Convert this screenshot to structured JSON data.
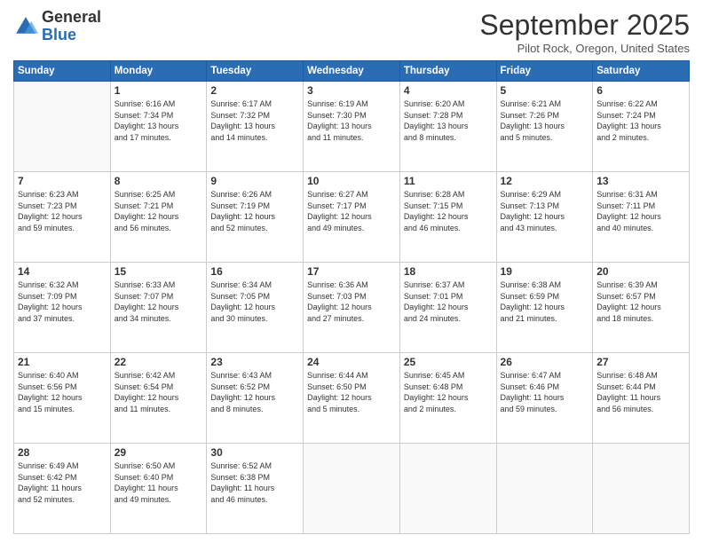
{
  "logo": {
    "general": "General",
    "blue": "Blue"
  },
  "header": {
    "month": "September 2025",
    "location": "Pilot Rock, Oregon, United States"
  },
  "weekdays": [
    "Sunday",
    "Monday",
    "Tuesday",
    "Wednesday",
    "Thursday",
    "Friday",
    "Saturday"
  ],
  "weeks": [
    [
      {
        "day": "",
        "info": ""
      },
      {
        "day": "1",
        "info": "Sunrise: 6:16 AM\nSunset: 7:34 PM\nDaylight: 13 hours\nand 17 minutes."
      },
      {
        "day": "2",
        "info": "Sunrise: 6:17 AM\nSunset: 7:32 PM\nDaylight: 13 hours\nand 14 minutes."
      },
      {
        "day": "3",
        "info": "Sunrise: 6:19 AM\nSunset: 7:30 PM\nDaylight: 13 hours\nand 11 minutes."
      },
      {
        "day": "4",
        "info": "Sunrise: 6:20 AM\nSunset: 7:28 PM\nDaylight: 13 hours\nand 8 minutes."
      },
      {
        "day": "5",
        "info": "Sunrise: 6:21 AM\nSunset: 7:26 PM\nDaylight: 13 hours\nand 5 minutes."
      },
      {
        "day": "6",
        "info": "Sunrise: 6:22 AM\nSunset: 7:24 PM\nDaylight: 13 hours\nand 2 minutes."
      }
    ],
    [
      {
        "day": "7",
        "info": "Sunrise: 6:23 AM\nSunset: 7:23 PM\nDaylight: 12 hours\nand 59 minutes."
      },
      {
        "day": "8",
        "info": "Sunrise: 6:25 AM\nSunset: 7:21 PM\nDaylight: 12 hours\nand 56 minutes."
      },
      {
        "day": "9",
        "info": "Sunrise: 6:26 AM\nSunset: 7:19 PM\nDaylight: 12 hours\nand 52 minutes."
      },
      {
        "day": "10",
        "info": "Sunrise: 6:27 AM\nSunset: 7:17 PM\nDaylight: 12 hours\nand 49 minutes."
      },
      {
        "day": "11",
        "info": "Sunrise: 6:28 AM\nSunset: 7:15 PM\nDaylight: 12 hours\nand 46 minutes."
      },
      {
        "day": "12",
        "info": "Sunrise: 6:29 AM\nSunset: 7:13 PM\nDaylight: 12 hours\nand 43 minutes."
      },
      {
        "day": "13",
        "info": "Sunrise: 6:31 AM\nSunset: 7:11 PM\nDaylight: 12 hours\nand 40 minutes."
      }
    ],
    [
      {
        "day": "14",
        "info": "Sunrise: 6:32 AM\nSunset: 7:09 PM\nDaylight: 12 hours\nand 37 minutes."
      },
      {
        "day": "15",
        "info": "Sunrise: 6:33 AM\nSunset: 7:07 PM\nDaylight: 12 hours\nand 34 minutes."
      },
      {
        "day": "16",
        "info": "Sunrise: 6:34 AM\nSunset: 7:05 PM\nDaylight: 12 hours\nand 30 minutes."
      },
      {
        "day": "17",
        "info": "Sunrise: 6:36 AM\nSunset: 7:03 PM\nDaylight: 12 hours\nand 27 minutes."
      },
      {
        "day": "18",
        "info": "Sunrise: 6:37 AM\nSunset: 7:01 PM\nDaylight: 12 hours\nand 24 minutes."
      },
      {
        "day": "19",
        "info": "Sunrise: 6:38 AM\nSunset: 6:59 PM\nDaylight: 12 hours\nand 21 minutes."
      },
      {
        "day": "20",
        "info": "Sunrise: 6:39 AM\nSunset: 6:57 PM\nDaylight: 12 hours\nand 18 minutes."
      }
    ],
    [
      {
        "day": "21",
        "info": "Sunrise: 6:40 AM\nSunset: 6:56 PM\nDaylight: 12 hours\nand 15 minutes."
      },
      {
        "day": "22",
        "info": "Sunrise: 6:42 AM\nSunset: 6:54 PM\nDaylight: 12 hours\nand 11 minutes."
      },
      {
        "day": "23",
        "info": "Sunrise: 6:43 AM\nSunset: 6:52 PM\nDaylight: 12 hours\nand 8 minutes."
      },
      {
        "day": "24",
        "info": "Sunrise: 6:44 AM\nSunset: 6:50 PM\nDaylight: 12 hours\nand 5 minutes."
      },
      {
        "day": "25",
        "info": "Sunrise: 6:45 AM\nSunset: 6:48 PM\nDaylight: 12 hours\nand 2 minutes."
      },
      {
        "day": "26",
        "info": "Sunrise: 6:47 AM\nSunset: 6:46 PM\nDaylight: 11 hours\nand 59 minutes."
      },
      {
        "day": "27",
        "info": "Sunrise: 6:48 AM\nSunset: 6:44 PM\nDaylight: 11 hours\nand 56 minutes."
      }
    ],
    [
      {
        "day": "28",
        "info": "Sunrise: 6:49 AM\nSunset: 6:42 PM\nDaylight: 11 hours\nand 52 minutes."
      },
      {
        "day": "29",
        "info": "Sunrise: 6:50 AM\nSunset: 6:40 PM\nDaylight: 11 hours\nand 49 minutes."
      },
      {
        "day": "30",
        "info": "Sunrise: 6:52 AM\nSunset: 6:38 PM\nDaylight: 11 hours\nand 46 minutes."
      },
      {
        "day": "",
        "info": ""
      },
      {
        "day": "",
        "info": ""
      },
      {
        "day": "",
        "info": ""
      },
      {
        "day": "",
        "info": ""
      }
    ]
  ]
}
